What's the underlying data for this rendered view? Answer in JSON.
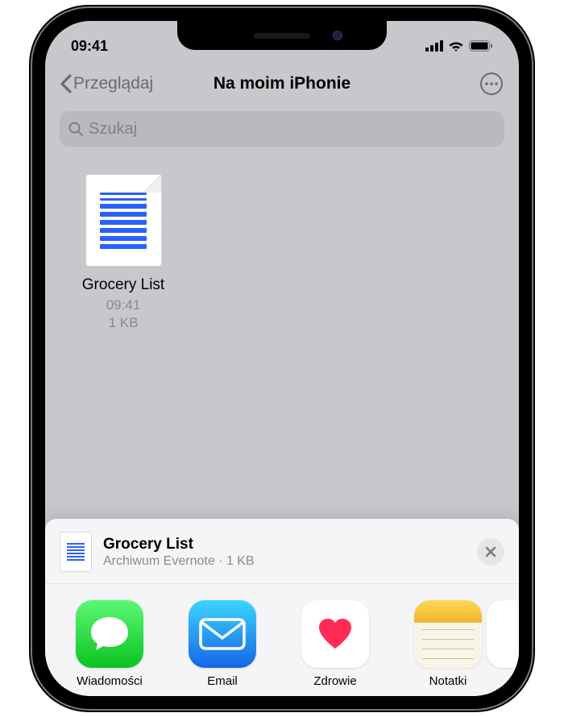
{
  "status": {
    "time": "09:41"
  },
  "nav": {
    "back_label": "Przeglądaj",
    "title": "Na moim iPhonie"
  },
  "search": {
    "placeholder": "Szukaj"
  },
  "files": [
    {
      "name": "Grocery List",
      "time": "09:41",
      "size": "1 KB"
    }
  ],
  "share": {
    "title": "Grocery List",
    "subtitle": "Archiwum Evernote · 1 KB",
    "apps": [
      {
        "label": "Wiadomości"
      },
      {
        "label": "Email"
      },
      {
        "label": "Zdrowie"
      },
      {
        "label": "Notatki"
      }
    ]
  }
}
